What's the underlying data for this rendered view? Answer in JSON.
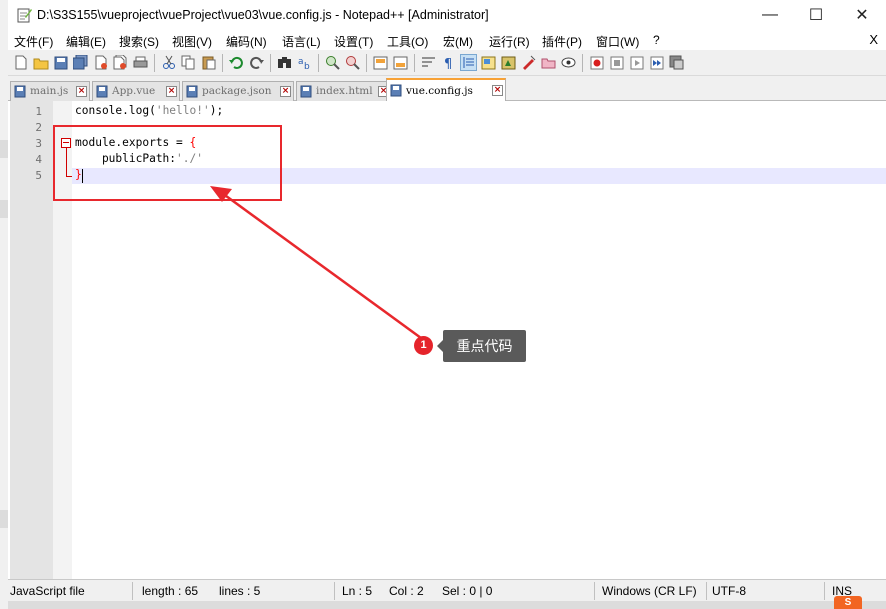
{
  "window": {
    "title": "D:\\S3S155\\vueproject\\vueProject\\vue03\\vue.config.js - Notepad++ [Administrator]",
    "minimize_glyph": "—",
    "maximize_glyph": "☐",
    "close_glyph": "✕"
  },
  "menu": {
    "items": [
      "文件(F)",
      "编辑(E)",
      "搜索(S)",
      "视图(V)",
      "编码(N)",
      "语言(L)",
      "设置(T)",
      "工具(O)",
      "宏(M)",
      "运行(R)",
      "插件(P)",
      "窗口(W)",
      "?"
    ],
    "close_label": "X"
  },
  "toolbar": {
    "icons": [
      "new-file-icon",
      "open-file-icon",
      "save-icon",
      "save-all-icon",
      "close-icon",
      "close-all-icon",
      "print-icon",
      "cut-icon",
      "copy-icon",
      "paste-icon",
      "undo-icon",
      "redo-icon",
      "find-icon",
      "replace-icon",
      "zoom-in-icon",
      "zoom-out-icon",
      "sync-vertical-icon",
      "sync-horizontal-icon",
      "word-wrap-icon",
      "show-all-characters-icon",
      "indent-guide-icon",
      "user-language-icon",
      "document-map-icon",
      "function-list-icon",
      "folder-workspace-icon",
      "monitoring-icon",
      "record-macro-icon",
      "stop-record-icon",
      "play-macro-icon",
      "run-macro-multiple-icon",
      "save-macro-icon"
    ]
  },
  "tabs": [
    {
      "label": "main.js",
      "active": false
    },
    {
      "label": "App.vue",
      "active": false
    },
    {
      "label": "package.json",
      "active": false
    },
    {
      "label": "index.html",
      "active": false
    },
    {
      "label": "vue.config.js",
      "active": true
    }
  ],
  "editor": {
    "line_numbers": [
      "1",
      "2",
      "3",
      "4",
      "5"
    ],
    "lines": [
      {
        "segments": [
          {
            "text": "console.log(",
            "style": "plain"
          },
          {
            "text": "'hello!'",
            "style": "str"
          },
          {
            "text": ");",
            "style": "plain"
          }
        ]
      },
      {
        "segments": []
      },
      {
        "segments": [
          {
            "text": "module.exports ",
            "style": "plain"
          },
          {
            "text": "=",
            "style": "plain"
          },
          {
            "text": " {",
            "style": "op"
          }
        ]
      },
      {
        "segments": [
          {
            "text": "    publicPath:",
            "style": "plain"
          },
          {
            "text": "'./'",
            "style": "str"
          }
        ]
      },
      {
        "segments": [
          {
            "text": "}",
            "style": "op"
          }
        ]
      }
    ],
    "current_line": 5
  },
  "annotation": {
    "badge_number": "1",
    "callout_text": "重点代码",
    "color": "#e8282d"
  },
  "status": {
    "file_type": "JavaScript file",
    "length": "length : 65",
    "lines": "lines : 5",
    "ln": "Ln : 5",
    "col": "Col : 2",
    "sel": "Sel : 0 | 0",
    "eol": "Windows (CR LF)",
    "encoding": "UTF-8",
    "mode": "INS"
  },
  "taskbar": {
    "ime_label": "S"
  }
}
